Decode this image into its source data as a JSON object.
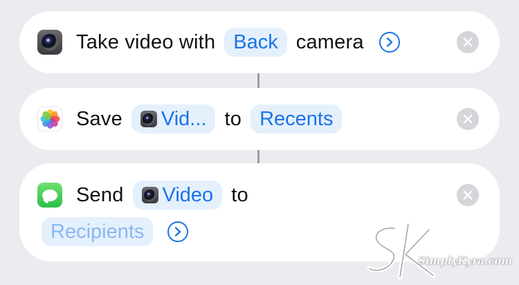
{
  "actions": [
    {
      "app_icon": "camera-app-icon",
      "text_before": "Take video with",
      "param": "Back",
      "text_after": "camera"
    },
    {
      "app_icon": "photos-app-icon",
      "text_before": "Save",
      "param": "Vid...",
      "param_icon": "camera-app-icon",
      "text_middle": "to",
      "param2": "Recents"
    },
    {
      "app_icon": "messages-app-icon",
      "text_before": "Send",
      "param": "Video",
      "param_icon": "camera-app-icon",
      "text_middle": "to",
      "placeholder": "Recipients"
    }
  ],
  "icons": {
    "expand": "chevron-right-circle-icon",
    "remove": "close-circle-icon"
  },
  "colors": {
    "background": "#EBEBF0",
    "card": "#FFFFFF",
    "accent": "#1A73E8",
    "pill": "#E5F0FD",
    "placeholder": "#89B8F0",
    "clear_button": "#D5D5DA"
  },
  "watermark": {
    "text": "SimplyKyra.com"
  }
}
